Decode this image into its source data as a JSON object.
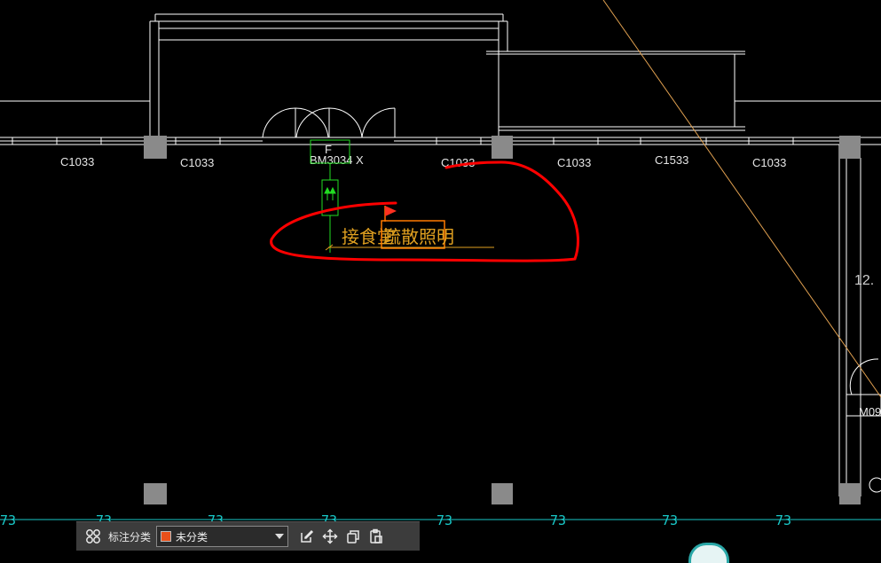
{
  "window_labels": {
    "C1033_1": "C1033",
    "C1033_2": "C1033",
    "door": "BM3034 X",
    "C1033_3": "C1033",
    "C1033_4": "C1033",
    "C1533": "C1533",
    "C1033_5": "C1033",
    "fire_box_letter": "F",
    "right_room_area": "12.",
    "right_door": "M09"
  },
  "annotation": {
    "text_left": "接食堂",
    "text_highlight": "疏散照明"
  },
  "axis_marks": [
    "73",
    "73",
    "73",
    "73",
    "73",
    "73",
    "73",
    "73"
  ],
  "toolbar": {
    "category_label": "标注分类",
    "category_value": "未分类"
  },
  "icons": [
    "grid-icon",
    "edit-icon",
    "move-icon",
    "copy-icon",
    "paste-icon",
    "dropdown-caret-icon"
  ],
  "colors": {
    "background": "#000000",
    "wall_lines": "#ffffff",
    "axis": "#19c8c8",
    "markup_circle": "#ff0000",
    "annotation_text": "#e0a020",
    "highlight_box": "#ff7a00",
    "fire_symbol": "#22dd22",
    "diagonal": "#e0a050",
    "column": "#8a8a8a"
  }
}
